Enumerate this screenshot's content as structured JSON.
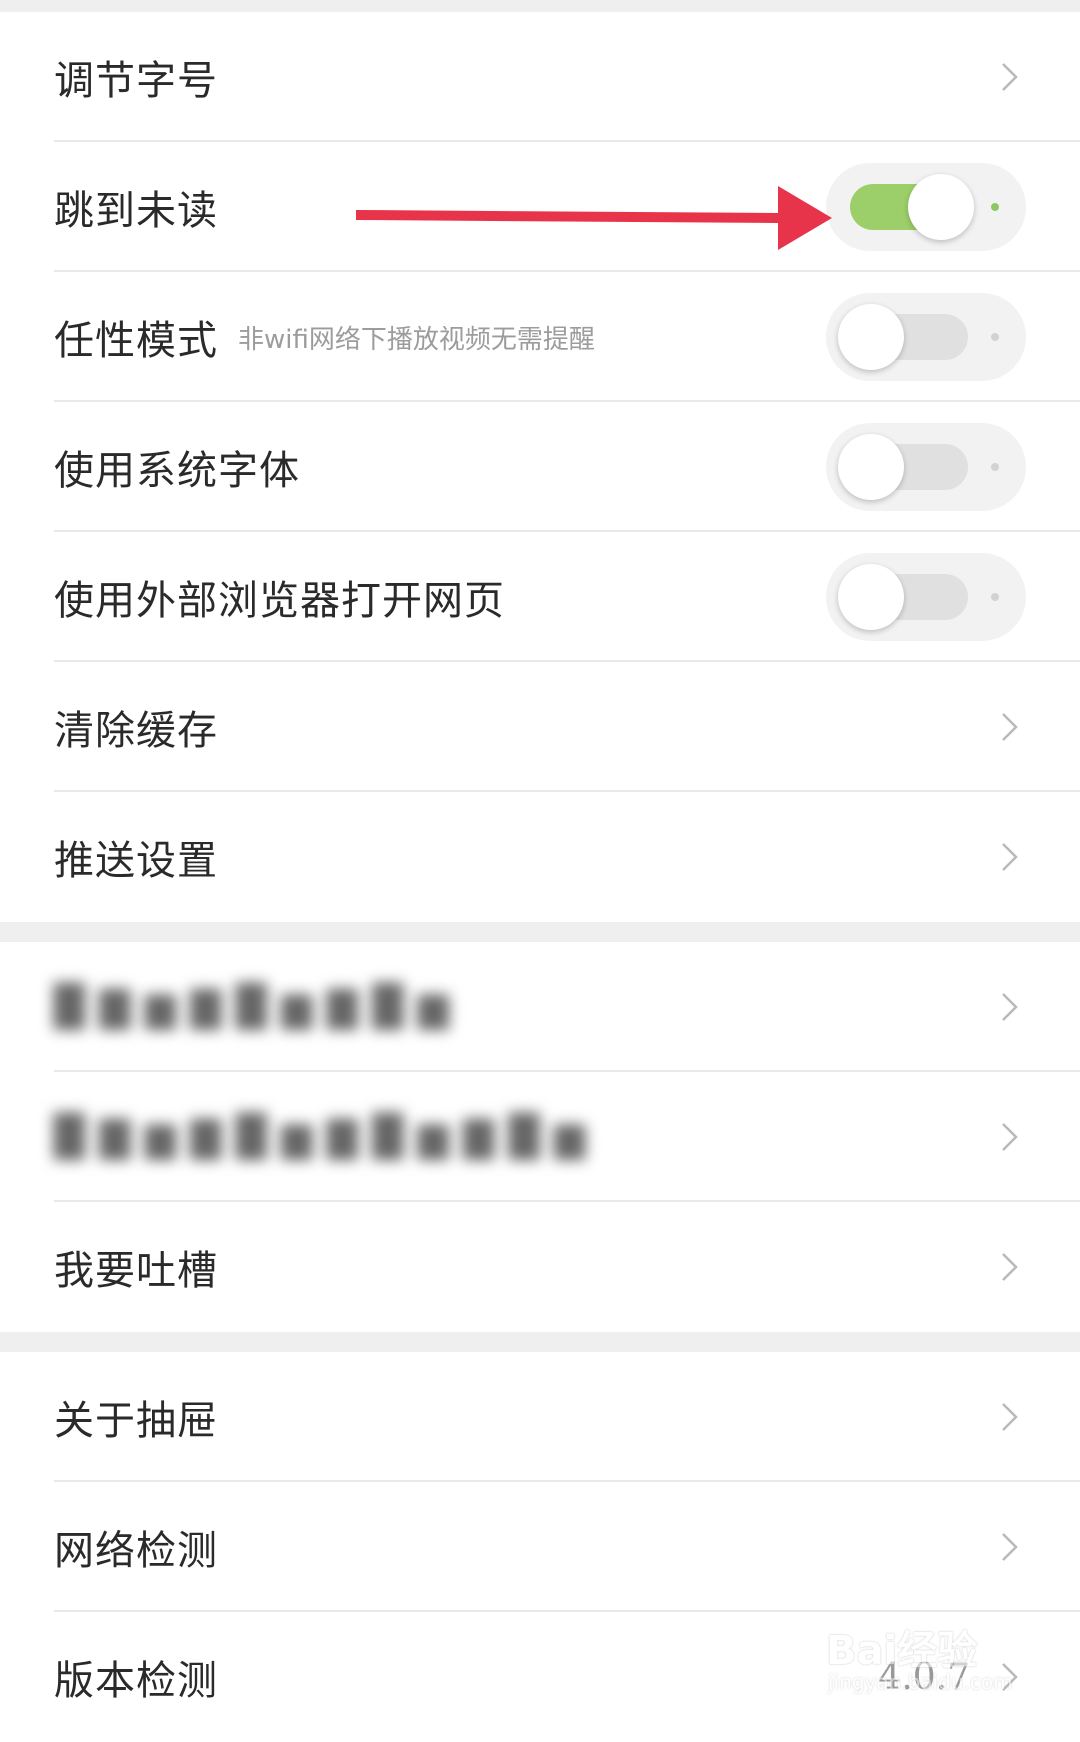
{
  "section1": {
    "items": [
      {
        "label": "调节字号",
        "control": "chevron"
      },
      {
        "label": "跳到未读",
        "control": "switch",
        "on": true
      },
      {
        "label": "任性模式",
        "sublabel": "非wifi网络下播放视频无需提醒",
        "control": "switch",
        "on": false
      },
      {
        "label": "使用系统字体",
        "control": "switch",
        "on": false
      },
      {
        "label": "使用外部浏览器打开网页",
        "control": "switch",
        "on": false
      },
      {
        "label": "清除缓存",
        "control": "chevron"
      },
      {
        "label": "推送设置",
        "control": "chevron"
      }
    ]
  },
  "section2": {
    "items": [
      {
        "label": "我要吐槽",
        "control": "chevron"
      }
    ]
  },
  "section3": {
    "items": [
      {
        "label": "关于抽屉",
        "control": "chevron"
      },
      {
        "label": "网络检测",
        "control": "chevron"
      },
      {
        "label": "版本检测",
        "control": "chevron",
        "value": "4.0.7"
      }
    ]
  },
  "watermark": {
    "brand": "Bai经验",
    "url": "jingyan.baidu.com"
  },
  "colors": {
    "switch_on_track": "#9ccf6a",
    "switch_off_track": "#e0e0e0",
    "annotation_arrow": "#e8344a",
    "separator_band": "#efefef"
  },
  "icons": {
    "row_action": "chevron-right-icon",
    "annotation": "arrow-right-icon"
  }
}
